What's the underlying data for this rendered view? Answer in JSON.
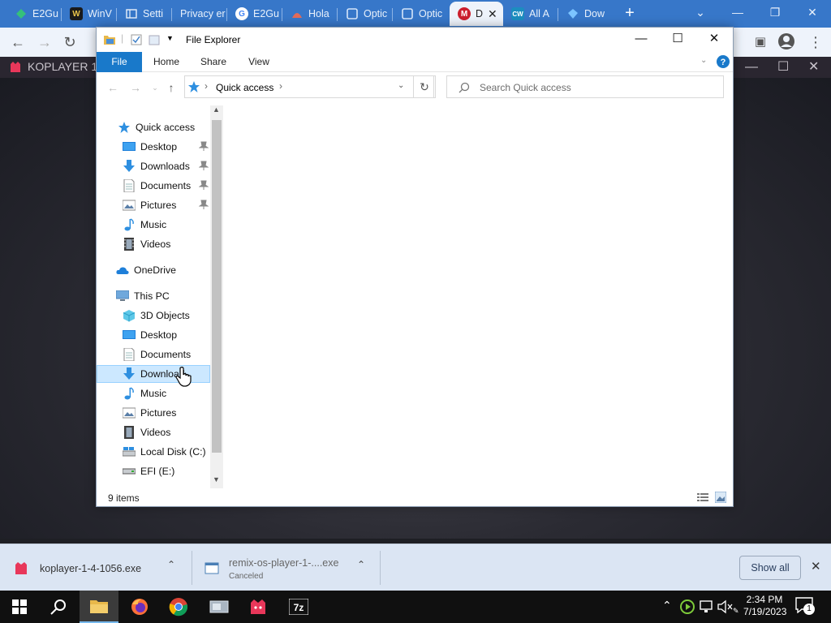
{
  "browser": {
    "tabs": [
      {
        "label": "E2Gu",
        "icon": "e2g-favicon",
        "color": "#2e8b57"
      },
      {
        "label": "WinV",
        "icon": "w-favicon",
        "color": "#1a1a1a"
      },
      {
        "label": "Setti",
        "icon": "settings-favicon",
        "color": "#3a3a3a"
      },
      {
        "label": "Privacy er",
        "icon": "",
        "color": ""
      },
      {
        "label": "E2Gu",
        "icon": "google-favicon",
        "color": "#ffffff"
      },
      {
        "label": "Hola",
        "icon": "hola-favicon",
        "color": "#e26b5a"
      },
      {
        "label": "Optic",
        "icon": "optic-favicon",
        "color": "#3d86d9"
      },
      {
        "label": "Optic",
        "icon": "optic-favicon",
        "color": "#3d86d9"
      },
      {
        "label": "D",
        "icon": "m-favicon",
        "color": "#cc1f2d",
        "active": true
      },
      {
        "label": "All A",
        "icon": "cw-favicon",
        "color": "#1c8dbf"
      },
      {
        "label": "Dow",
        "icon": "diamond-favicon",
        "color": "#1da1f2"
      }
    ],
    "new_tab": "+",
    "koplayer_title": "KOPLAYER 1"
  },
  "explorer": {
    "title": "File Explorer",
    "ribbon_tabs": [
      "File",
      "Home",
      "Share",
      "View"
    ],
    "address": {
      "path": "Quick access"
    },
    "search_placeholder": "Search Quick access",
    "nav": {
      "quick_access": {
        "label": "Quick access"
      },
      "quick_items": [
        {
          "label": "Desktop",
          "icon": "desktop-icon",
          "pinned": true
        },
        {
          "label": "Downloads",
          "icon": "downloads-icon",
          "pinned": true
        },
        {
          "label": "Documents",
          "icon": "documents-icon",
          "pinned": true
        },
        {
          "label": "Pictures",
          "icon": "pictures-icon",
          "pinned": true
        },
        {
          "label": "Music",
          "icon": "music-icon",
          "pinned": false
        },
        {
          "label": "Videos",
          "icon": "videos-icon",
          "pinned": false
        }
      ],
      "onedrive": {
        "label": "OneDrive"
      },
      "this_pc": {
        "label": "This PC"
      },
      "pc_items": [
        {
          "label": "3D Objects",
          "icon": "3d-objects-icon"
        },
        {
          "label": "Desktop",
          "icon": "desktop-icon"
        },
        {
          "label": "Documents",
          "icon": "documents-icon"
        },
        {
          "label": "Downloads",
          "icon": "downloads-icon",
          "selected": true
        },
        {
          "label": "Music",
          "icon": "music-icon"
        },
        {
          "label": "Pictures",
          "icon": "pictures-icon"
        },
        {
          "label": "Videos",
          "icon": "videos-icon"
        },
        {
          "label": "Local Disk (C:)",
          "icon": "local-disk-icon"
        },
        {
          "label": "EFI (E:)",
          "icon": "drive-icon"
        }
      ]
    },
    "status": {
      "count": "9 items"
    }
  },
  "downloads": {
    "items": [
      {
        "name": "koplayer-1-4-1056.exe",
        "status": ""
      },
      {
        "name": "remix-os-player-1-....exe",
        "status": "Canceled"
      }
    ],
    "show_all": "Show all"
  },
  "taskbar": {
    "time": "2:34 PM",
    "date": "7/19/2023",
    "notification_count": "1"
  }
}
